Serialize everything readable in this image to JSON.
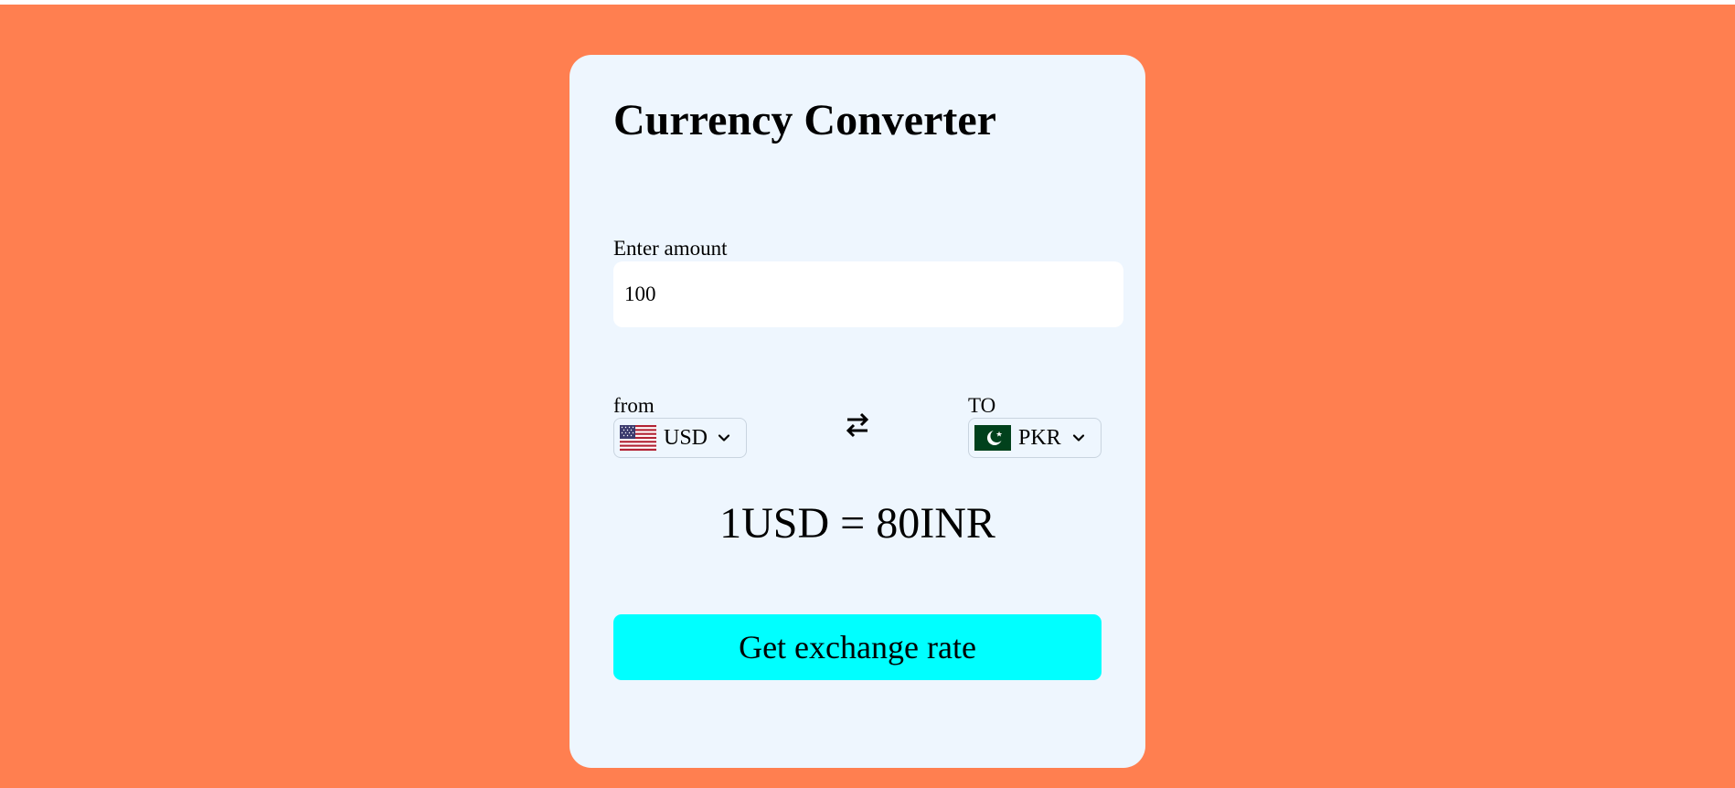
{
  "colors": {
    "background": "#ff7f50",
    "card": "#eef6fe",
    "button": "#00ffff"
  },
  "app": {
    "title": "Currency Converter"
  },
  "amount": {
    "label": "Enter amount",
    "value": "100"
  },
  "from": {
    "label": "from",
    "currency": "USD",
    "flag": "us-flag-icon"
  },
  "to": {
    "label": "TO",
    "currency": "PKR",
    "flag": "pk-flag-icon"
  },
  "swap": {
    "icon": "swap-arrows-icon"
  },
  "rate": {
    "text": "1USD = 80INR"
  },
  "button": {
    "label": "Get exchange rate"
  }
}
